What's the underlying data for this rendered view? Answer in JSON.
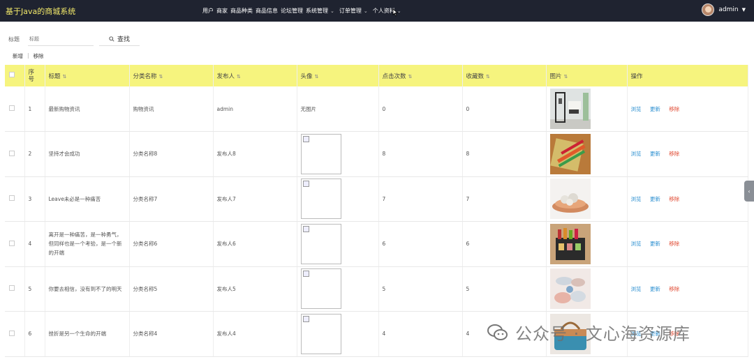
{
  "header": {
    "title": "基于Java的商城系统",
    "nav": [
      {
        "label": "用户",
        "dropdown": false
      },
      {
        "label": "商家",
        "dropdown": false
      },
      {
        "label": "商品种类",
        "dropdown": false
      },
      {
        "label": "商品信息",
        "dropdown": false
      },
      {
        "label": "论坛管理",
        "dropdown": false
      },
      {
        "label": "系统管理",
        "dropdown": true
      },
      {
        "label": "订单管理",
        "dropdown": true
      },
      {
        "label": "个人资料",
        "dropdown": true
      }
    ],
    "user": "admin"
  },
  "search": {
    "label": "标题",
    "placeholder": "标题",
    "button": "查找"
  },
  "actions": {
    "add": "新增",
    "remove": "移除"
  },
  "table": {
    "columns": [
      "序号",
      "标题",
      "分类名称",
      "发布人",
      "头像",
      "点击次数",
      "收藏数",
      "图片",
      "操作"
    ],
    "rows": [
      {
        "no": "1",
        "title": "最新购物资讯",
        "category": "购物资讯",
        "publisher": "admin",
        "avatar": "无图片",
        "clicks": "0",
        "favs": "0",
        "pic": "shelf"
      },
      {
        "no": "2",
        "title": "坚持才会成功",
        "category": "分类名称8",
        "publisher": "发布人8",
        "avatar": "",
        "clicks": "8",
        "favs": "8",
        "pic": "cutlery"
      },
      {
        "no": "3",
        "title": "Leave未必是一种痛苦",
        "category": "分类名称7",
        "publisher": "发布人7",
        "avatar": "",
        "clicks": "7",
        "favs": "7",
        "pic": "bowl"
      },
      {
        "no": "4",
        "title": "离开是一种痛苦，是一种勇气，但同样也是一个考验，是一个新的开端",
        "category": "分类名称6",
        "publisher": "发布人6",
        "avatar": "",
        "clicks": "6",
        "favs": "6",
        "pic": "spice-rack"
      },
      {
        "no": "5",
        "title": "你要去相信，没有到不了的明天",
        "category": "分类名称5",
        "publisher": "发布人5",
        "avatar": "",
        "clicks": "5",
        "favs": "5",
        "pic": "ceramics"
      },
      {
        "no": "6",
        "title": "挫折是另一个生命的开端",
        "category": "分类名称4",
        "publisher": "发布人4",
        "avatar": "",
        "clicks": "4",
        "favs": "4",
        "pic": "bag"
      }
    ],
    "ops": {
      "view": "浏览",
      "update": "更新",
      "delete": "移除"
    }
  },
  "watermark": "公众号 · 文心海资源库",
  "colors": {
    "topbar": "#1f2330",
    "brand": "#f3e96a",
    "header_row": "#f6f47e",
    "link": "#2b8fd0",
    "danger": "#e0472f"
  }
}
